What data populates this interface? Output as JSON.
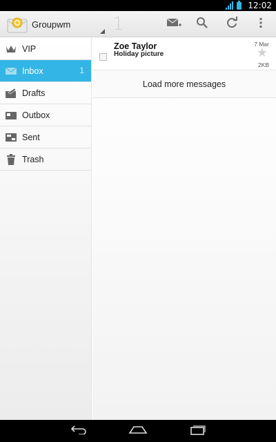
{
  "status_bar": {
    "time": "12:02"
  },
  "action_bar": {
    "account_name": "Groupwm",
    "unread_count": "1",
    "icons": [
      "compose-mail-icon",
      "search-icon",
      "refresh-icon",
      "overflow-menu-icon"
    ]
  },
  "folders": [
    {
      "label": "VIP",
      "icon": "crown-icon",
      "count": ""
    },
    {
      "label": "Inbox",
      "icon": "inbox-icon",
      "count": "1",
      "selected": true
    },
    {
      "label": "Drafts",
      "icon": "drafts-icon",
      "count": ""
    },
    {
      "label": "Outbox",
      "icon": "outbox-icon",
      "count": ""
    },
    {
      "label": "Sent",
      "icon": "sent-icon",
      "count": ""
    },
    {
      "label": "Trash",
      "icon": "trash-icon",
      "count": ""
    }
  ],
  "messages": [
    {
      "sender": "Zoe Taylor",
      "subject": "Holiday picture",
      "date": "7 Mar",
      "size": "2KB",
      "starred": false
    }
  ],
  "load_more_label": "Load more messages",
  "colors": {
    "accent": "#33b5e5",
    "status_bar": "#000000",
    "nav_bar": "#000000"
  },
  "nav_bar": {
    "icons": [
      "back-icon",
      "home-icon",
      "recent-apps-icon"
    ]
  }
}
